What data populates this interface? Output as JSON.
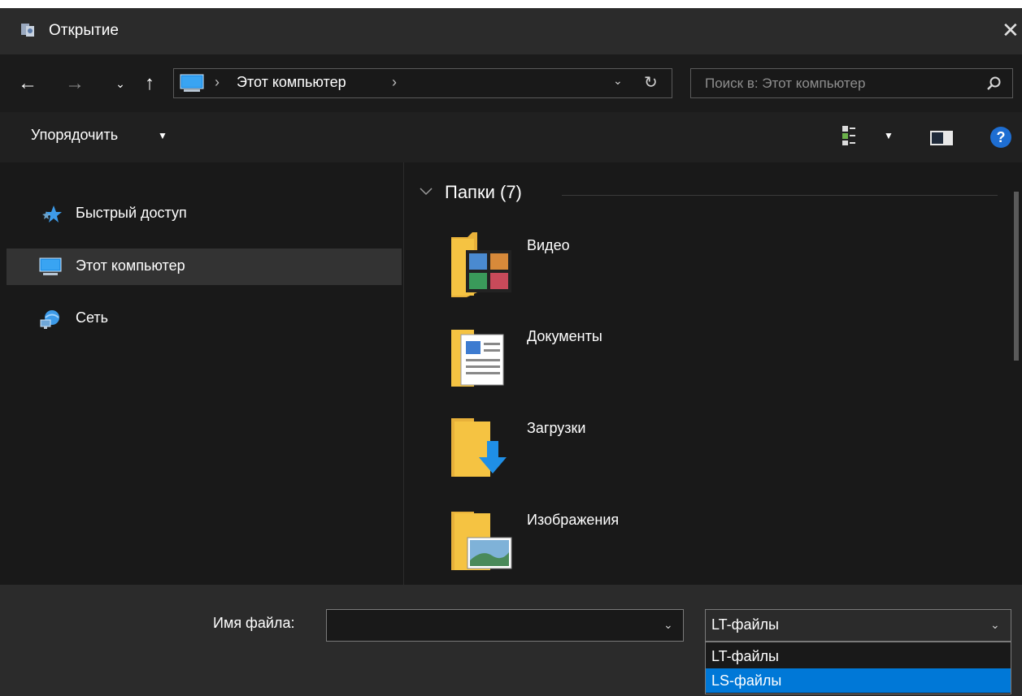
{
  "window": {
    "title": "Открытие",
    "icon": "app-icon",
    "close_glyph": "✕"
  },
  "nav": {
    "back": "←",
    "forward": "→",
    "recent": "⌄",
    "up": "↑",
    "address": {
      "crumb": "Этот компьютер",
      "sep": "›",
      "dropdown": "⌄",
      "refresh": "↻"
    },
    "search": {
      "placeholder": "Поиск в: Этот компьютер",
      "value": ""
    }
  },
  "toolbar": {
    "organize": "Упорядочить",
    "organize_arrow": "▼",
    "view_arrow": "▼",
    "help": "?"
  },
  "sidebar": {
    "items": [
      {
        "label": "Быстрый доступ",
        "icon": "star-icon",
        "selected": false
      },
      {
        "label": "Этот компьютер",
        "icon": "computer-icon",
        "selected": true
      },
      {
        "label": "Сеть",
        "icon": "network-icon",
        "selected": false
      }
    ]
  },
  "content": {
    "group": {
      "title": "Папки (7)"
    },
    "folders": [
      {
        "label": "Видео",
        "icon": "video-folder-icon"
      },
      {
        "label": "Документы",
        "icon": "documents-folder-icon"
      },
      {
        "label": "Загрузки",
        "icon": "downloads-folder-icon"
      },
      {
        "label": "Изображения",
        "icon": "pictures-folder-icon"
      }
    ]
  },
  "footer": {
    "filename_label": "Имя файла:",
    "filename_value": "",
    "dropdown_glyph": "⌄",
    "filetype": {
      "selected": "LT-файлы",
      "options": [
        "LT-файлы",
        "LS-файлы"
      ],
      "highlighted_option": "LS-файлы"
    }
  },
  "colors": {
    "accent": "#0078d7",
    "folder": "#f5c342",
    "background": "#191919",
    "titlebar": "#2b2b2b"
  }
}
